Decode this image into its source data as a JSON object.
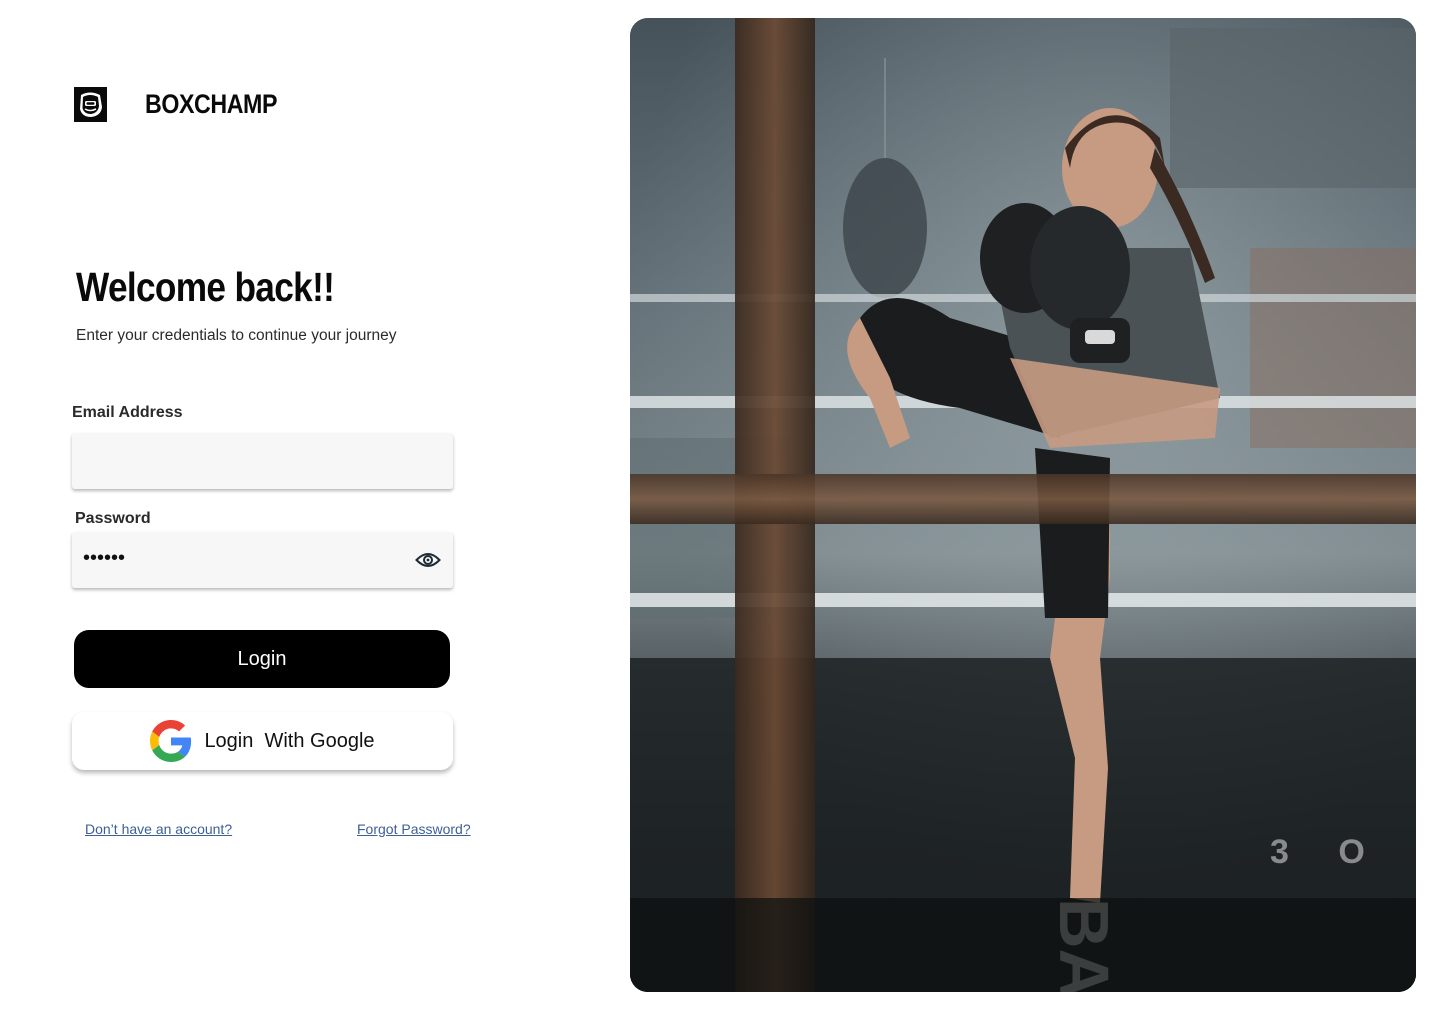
{
  "brand": {
    "name": "BOXCHAMP",
    "logo_icon": "boxer-helmet-icon"
  },
  "welcome": {
    "title": "Welcome back!!",
    "subtitle": "Enter your credentials to continue your journey"
  },
  "form": {
    "email": {
      "label": "Email Address",
      "value": "",
      "placeholder": ""
    },
    "password": {
      "label": "Password",
      "masked_value": "••••••",
      "toggle_icon": "eye-icon"
    }
  },
  "buttons": {
    "login_label": "Login",
    "google_label": "Login  With Google",
    "google_icon": "google-g-icon"
  },
  "links": {
    "signup": "Don’t have an account?",
    "forgot": "Forgot Password?"
  },
  "hero": {
    "image_icon": "boxing-woman-photo"
  },
  "colors": {
    "primary_button": "#000000",
    "link": "#3d5f96",
    "input_background": "#f7f7f7",
    "page_background": "#ffffff"
  }
}
